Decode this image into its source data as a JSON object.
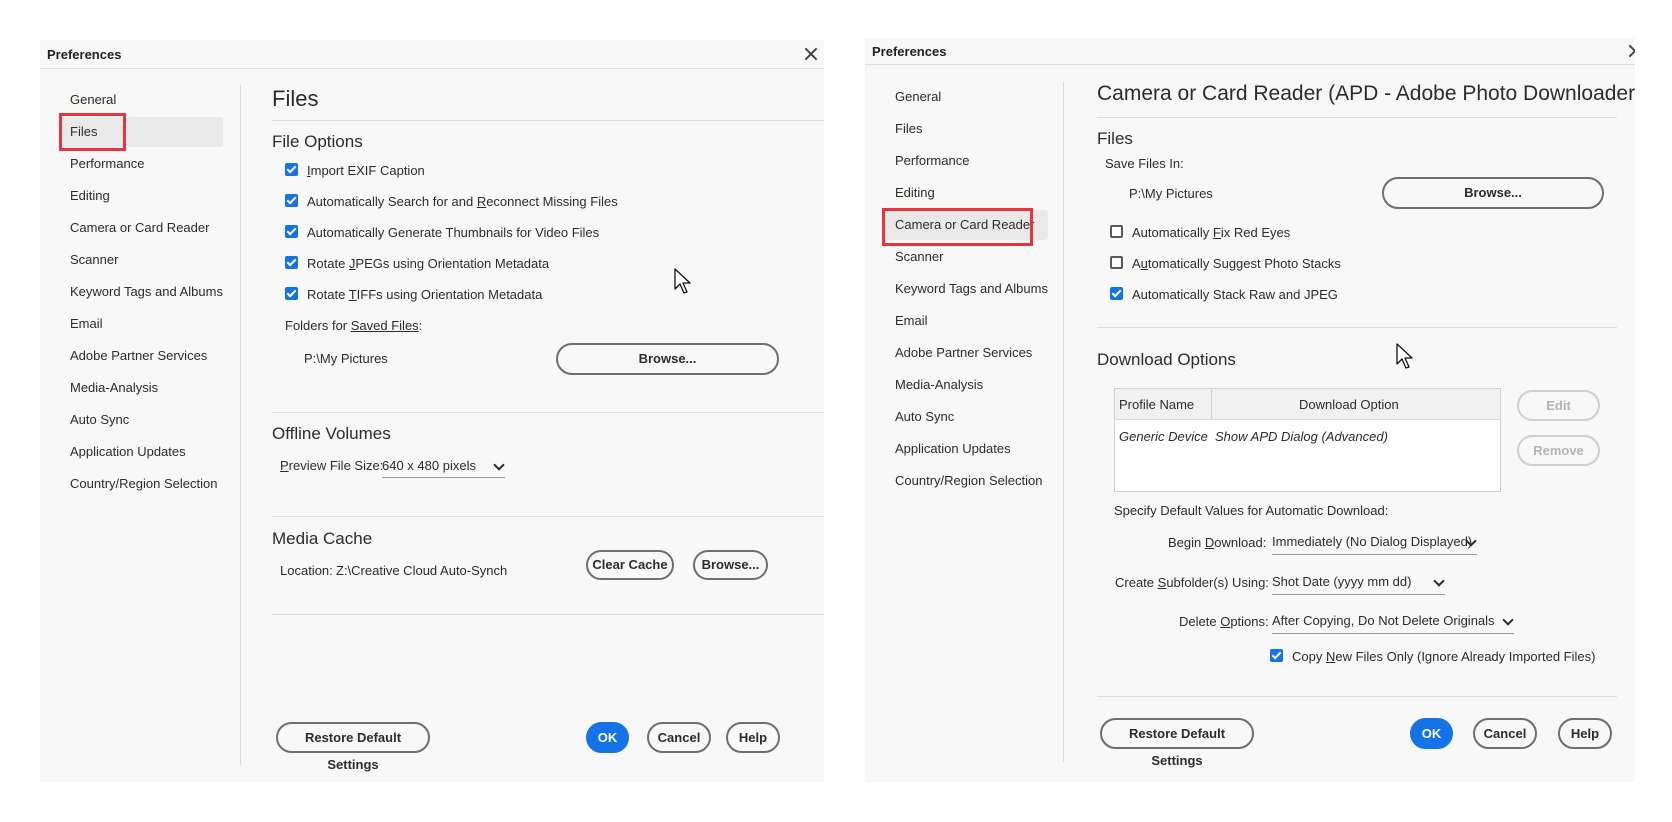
{
  "left": {
    "title": "Preferences",
    "nav": [
      "General",
      "Files",
      "Performance",
      "Editing",
      "Camera or Card Reader",
      "Scanner",
      "Keyword Tags and Albums",
      "Email",
      "Adobe Partner Services",
      "Media-Analysis",
      "Auto Sync",
      "Application Updates",
      "Country/Region Selection"
    ],
    "selected_nav": "Files",
    "heading": "Files",
    "file_options": {
      "title": "File Options",
      "checkboxes": [
        {
          "label": "Import EXIF Caption",
          "checked": true
        },
        {
          "label": "Automatically Search for and Reconnect Missing Files",
          "checked": true
        },
        {
          "label": "Automatically Generate Thumbnails for Video Files",
          "checked": true
        },
        {
          "label": "Rotate JPEGs using Orientation Metadata",
          "checked": true
        },
        {
          "label": "Rotate TIFFs using Orientation Metadata",
          "checked": true
        }
      ],
      "folders_label": "Folders for Saved Files:",
      "path": "P:\\My Pictures",
      "browse": "Browse..."
    },
    "offline": {
      "title": "Offline Volumes",
      "preview_label": "Preview File Size:",
      "preview_value": "640 x 480 pixels"
    },
    "media_cache": {
      "title": "Media Cache",
      "location_label": "Location:",
      "location_value": "Z:\\Creative Cloud Auto-Synch",
      "clear": "Clear Cache",
      "browse": "Browse..."
    },
    "footer": {
      "restore": "Restore Default Settings",
      "ok": "OK",
      "cancel": "Cancel",
      "help": "Help"
    }
  },
  "right": {
    "title": "Preferences",
    "nav": [
      "General",
      "Files",
      "Performance",
      "Editing",
      "Camera or Card Reader",
      "Scanner",
      "Keyword Tags and Albums",
      "Email",
      "Adobe Partner Services",
      "Media-Analysis",
      "Auto Sync",
      "Application Updates",
      "Country/Region Selection"
    ],
    "selected_nav": "Camera or Card Reader",
    "heading": "Camera or Card Reader (APD - Adobe Photo Downloader)",
    "files": {
      "title": "Files",
      "save_label": "Save Files In:",
      "path": "P:\\My Pictures",
      "browse": "Browse...",
      "checkboxes": [
        {
          "label": "Automatically Fix Red Eyes",
          "checked": false
        },
        {
          "label": "Automatically Suggest Photo Stacks",
          "checked": false
        },
        {
          "label": "Automatically Stack Raw and JPEG",
          "checked": true
        }
      ]
    },
    "download": {
      "title": "Download Options",
      "table": {
        "headers": [
          "Profile Name",
          "Download Option"
        ],
        "rows": [
          [
            "Generic Device",
            "Show APD Dialog (Advanced)"
          ]
        ]
      },
      "edit": "Edit",
      "remove": "Remove",
      "specify_label": "Specify Default Values for Automatic Download:",
      "begin_label": "Begin Download:",
      "begin_value": "Immediately (No Dialog Displayed)",
      "subfolder_label": "Create Subfolder(s) Using:",
      "subfolder_value": "Shot Date (yyyy mm dd)",
      "delete_label": "Delete Options:",
      "delete_value": "After Copying, Do Not Delete Originals",
      "copy_new_label": "Copy New Files Only (Ignore Already Imported Files)",
      "copy_new_checked": true
    },
    "footer": {
      "restore": "Restore Default Settings",
      "ok": "OK",
      "cancel": "Cancel",
      "help": "Help"
    }
  }
}
